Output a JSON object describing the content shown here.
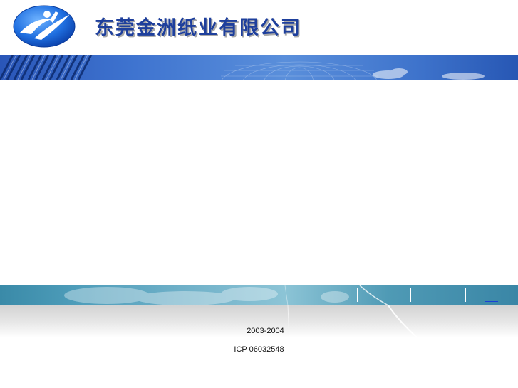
{
  "header": {
    "company_name": "东莞金洲纸业有限公司",
    "logo_icon": "company-logo-icon"
  },
  "footer": {
    "copyright": "2003-2004",
    "icp": "ICP 06032548"
  },
  "colors": {
    "brand_blue": "#1e3f9c",
    "banner_blue": "#3e73cf",
    "navbar_teal": "#4e9dba"
  }
}
